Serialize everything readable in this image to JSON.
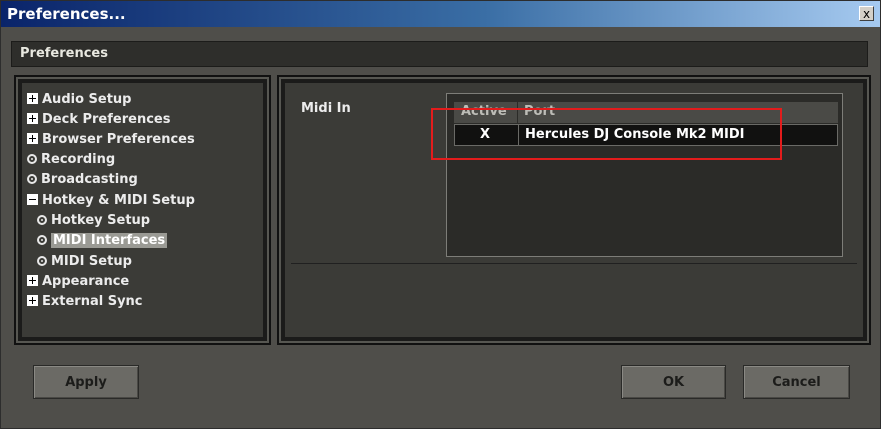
{
  "window": {
    "title": "Preferences...",
    "close_label": "x"
  },
  "header": {
    "title": "Preferences"
  },
  "tree": {
    "items": [
      {
        "label": "Audio Setup",
        "icon": "expand-plus-icon"
      },
      {
        "label": "Deck Preferences",
        "icon": "expand-plus-icon"
      },
      {
        "label": "Browser Preferences",
        "icon": "expand-plus-icon"
      },
      {
        "label": "Recording",
        "icon": "radio-bullet-icon"
      },
      {
        "label": "Broadcasting",
        "icon": "radio-bullet-icon"
      },
      {
        "label": "Hotkey & MIDI Setup",
        "icon": "collapse-minus-icon"
      },
      {
        "label": "Hotkey Setup",
        "icon": "radio-bullet-icon"
      },
      {
        "label": "MIDI Interfaces",
        "icon": "radio-bullet-icon",
        "selected": true
      },
      {
        "label": "MIDI Setup",
        "icon": "radio-bullet-icon"
      },
      {
        "label": "Appearance",
        "icon": "expand-plus-icon"
      },
      {
        "label": "External Sync",
        "icon": "expand-plus-icon"
      }
    ]
  },
  "midi": {
    "label": "Midi In",
    "columns": [
      "Active",
      "Port"
    ],
    "rows": [
      {
        "active": "X",
        "port": "Hercules DJ Console Mk2 MIDI"
      }
    ]
  },
  "buttons": {
    "apply": "Apply",
    "ok": "OK",
    "cancel": "Cancel"
  },
  "colors": {
    "highlight_box": "#e21c1c",
    "title_bar": "#0a246a",
    "panel_bg": "#3b3b37"
  }
}
